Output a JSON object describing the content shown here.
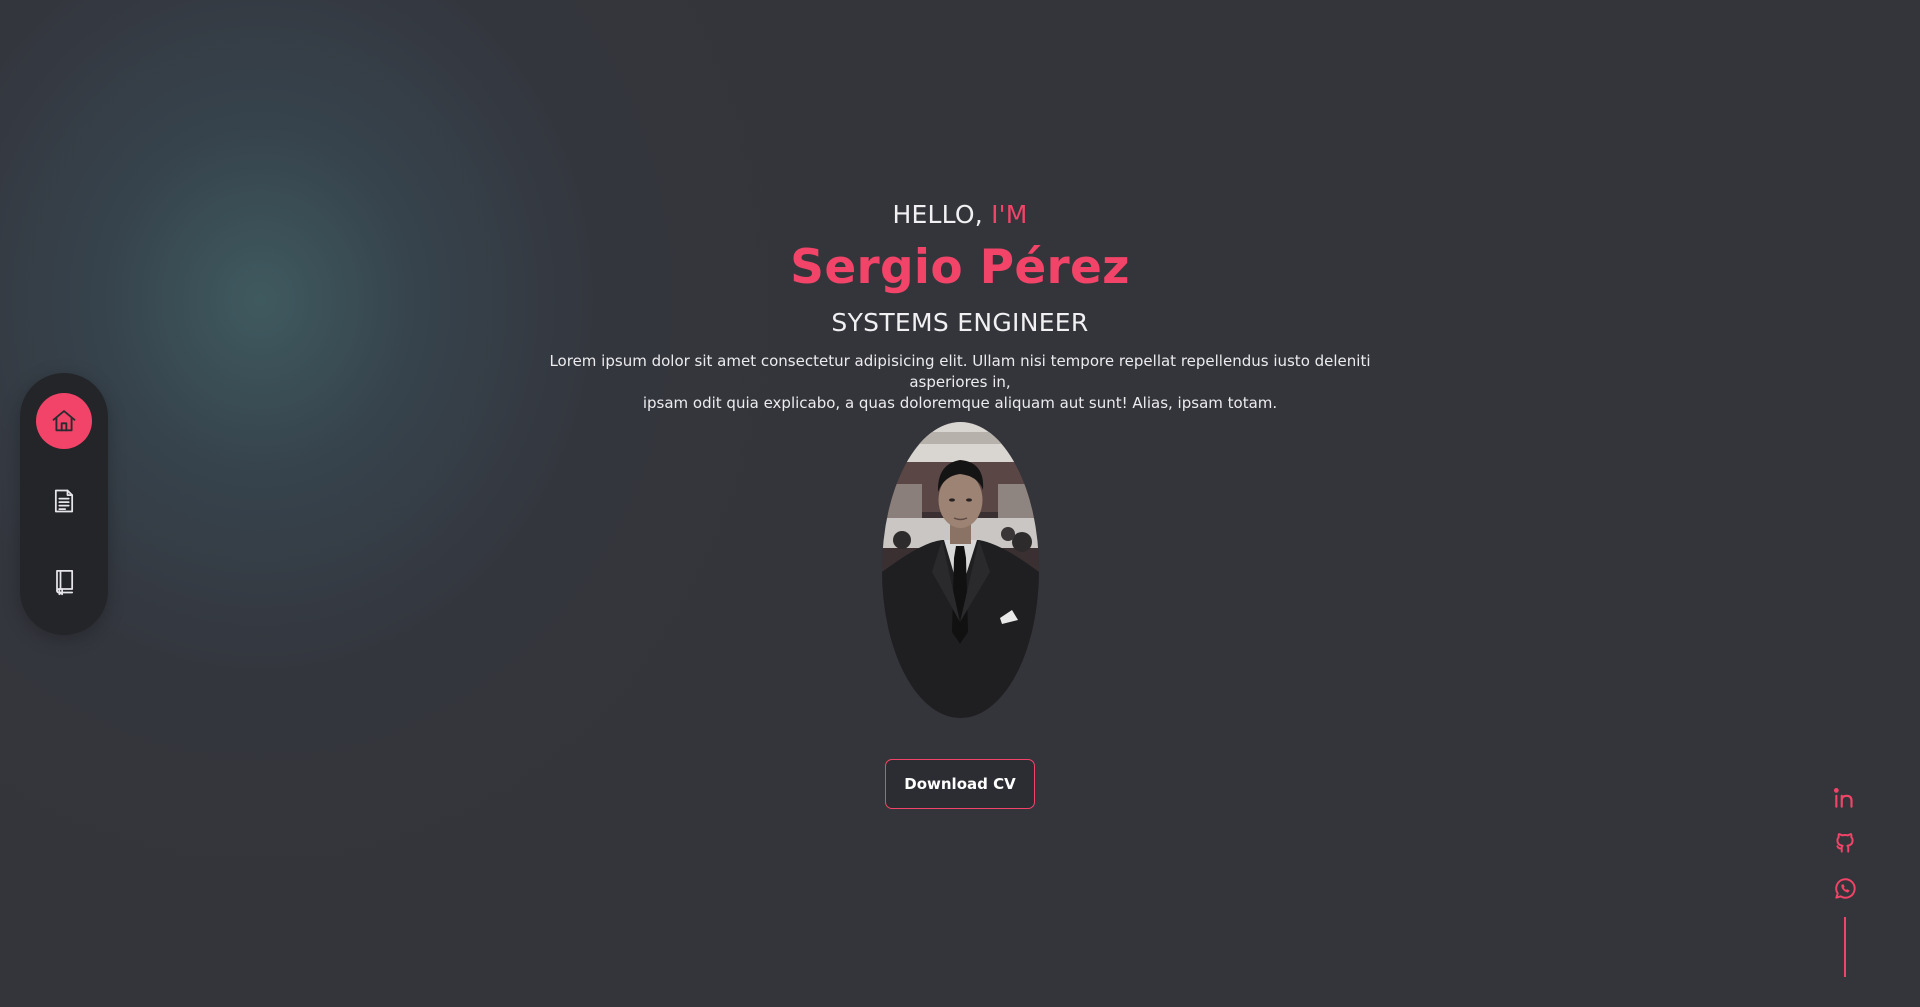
{
  "nav": {
    "items": [
      {
        "name": "home",
        "icon": "home-icon",
        "active": true
      },
      {
        "name": "resume",
        "icon": "document-icon",
        "active": false
      },
      {
        "name": "portfolio",
        "icon": "book-icon",
        "active": false
      }
    ]
  },
  "hero": {
    "greeting_prefix": "HELLO, ",
    "greeting_accent": "I'M",
    "name": "Sergio Pérez",
    "role": "SYSTEMS ENGINEER",
    "bio_line1": "Lorem ipsum dolor sit amet consectetur adipisicing elit. Ullam nisi tempore repellat repellendus iusto deleniti asperiores in,",
    "bio_line2": "ipsam odit quia explicabo, a quas doloremque aliquam aut sunt! Alias, ipsam totam.",
    "cv_label": "Download CV"
  },
  "social": {
    "items": [
      {
        "name": "linkedin",
        "icon": "linkedin-icon"
      },
      {
        "name": "github",
        "icon": "github-icon"
      },
      {
        "name": "whatsapp",
        "icon": "whatsapp-icon"
      }
    ]
  },
  "colors": {
    "accent": "#f14468",
    "background": "#34353a",
    "nav_background": "#242529",
    "text": "#f1f1f3"
  }
}
